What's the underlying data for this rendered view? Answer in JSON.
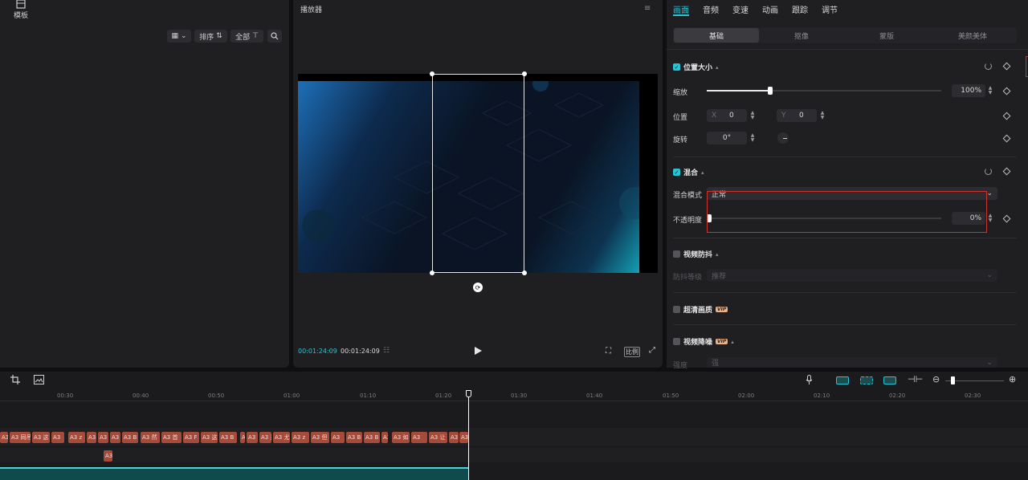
{
  "left_panel": {
    "template_label": "模板",
    "sort_label": "排序",
    "filter_label": "全部"
  },
  "player": {
    "title": "播放器",
    "current_time": "00:01:24:09",
    "total_time": "00:01:24:09",
    "ratio_label": "比例"
  },
  "props": {
    "tabs": [
      "画面",
      "音频",
      "变速",
      "动画",
      "跟踪",
      "调节"
    ],
    "segments": [
      "基础",
      "抠像",
      "蒙版",
      "美颜美体"
    ],
    "position_size": {
      "title": "位置大小",
      "scale_label": "缩放",
      "scale_value": "100%",
      "scale_level": 0.27,
      "position_label": "位置",
      "x_label": "X",
      "x_value": "0",
      "y_label": "Y",
      "y_value": "0",
      "rotate_label": "旋转",
      "rotate_value": "0°"
    },
    "blend": {
      "title": "混合",
      "mode_label": "混合模式",
      "mode_value": "正常",
      "opacity_label": "不透明度",
      "opacity_value": "0%",
      "opacity_level": 0.0
    },
    "stabilize": {
      "title": "视频防抖",
      "level_label": "防抖等级",
      "level_value": "推荐"
    },
    "hd": {
      "title": "超清画质",
      "vip_label": "VIP"
    },
    "denoise": {
      "title": "视频降噪",
      "vip_label": "VIP",
      "strength_label": "强度",
      "strength_value": "强"
    }
  },
  "timeline": {
    "ruler": [
      "00:30",
      "00:40",
      "00:50",
      "01:00",
      "01:10",
      "01:20",
      "01:30",
      "01:40",
      "01:50",
      "02:00",
      "02:10",
      "02:20",
      "02:30"
    ],
    "clips": [
      {
        "label": "A3"
      },
      {
        "label": "A3 同吊"
      },
      {
        "label": "A3 这"
      },
      {
        "label": "A3"
      },
      {
        "label": "A3 z"
      },
      {
        "label": "A3"
      },
      {
        "label": "A3"
      },
      {
        "label": "A3"
      },
      {
        "label": "A3 B"
      },
      {
        "label": "A3 然"
      },
      {
        "label": "A3 首"
      },
      {
        "label": "A3 F"
      },
      {
        "label": "A3 这"
      },
      {
        "label": "A3 B"
      },
      {
        "label": "A"
      },
      {
        "label": "A3"
      },
      {
        "label": "A3 这"
      },
      {
        "label": "A3 尤"
      },
      {
        "label": "A3 z"
      },
      {
        "label": "A3 但"
      },
      {
        "label": "A3"
      },
      {
        "label": "A3 B"
      },
      {
        "label": "A3 B"
      },
      {
        "label": "A3 大"
      },
      {
        "label": "A"
      },
      {
        "label": "A3 如"
      },
      {
        "label": "A3"
      },
      {
        "label": "A3 让"
      },
      {
        "label": "A3"
      },
      {
        "label": "A3"
      }
    ],
    "second_clip": "A3"
  },
  "colors": {
    "accent": "#29c3d6",
    "clip": "#a64a3a",
    "warning_box": "#d0302f"
  }
}
